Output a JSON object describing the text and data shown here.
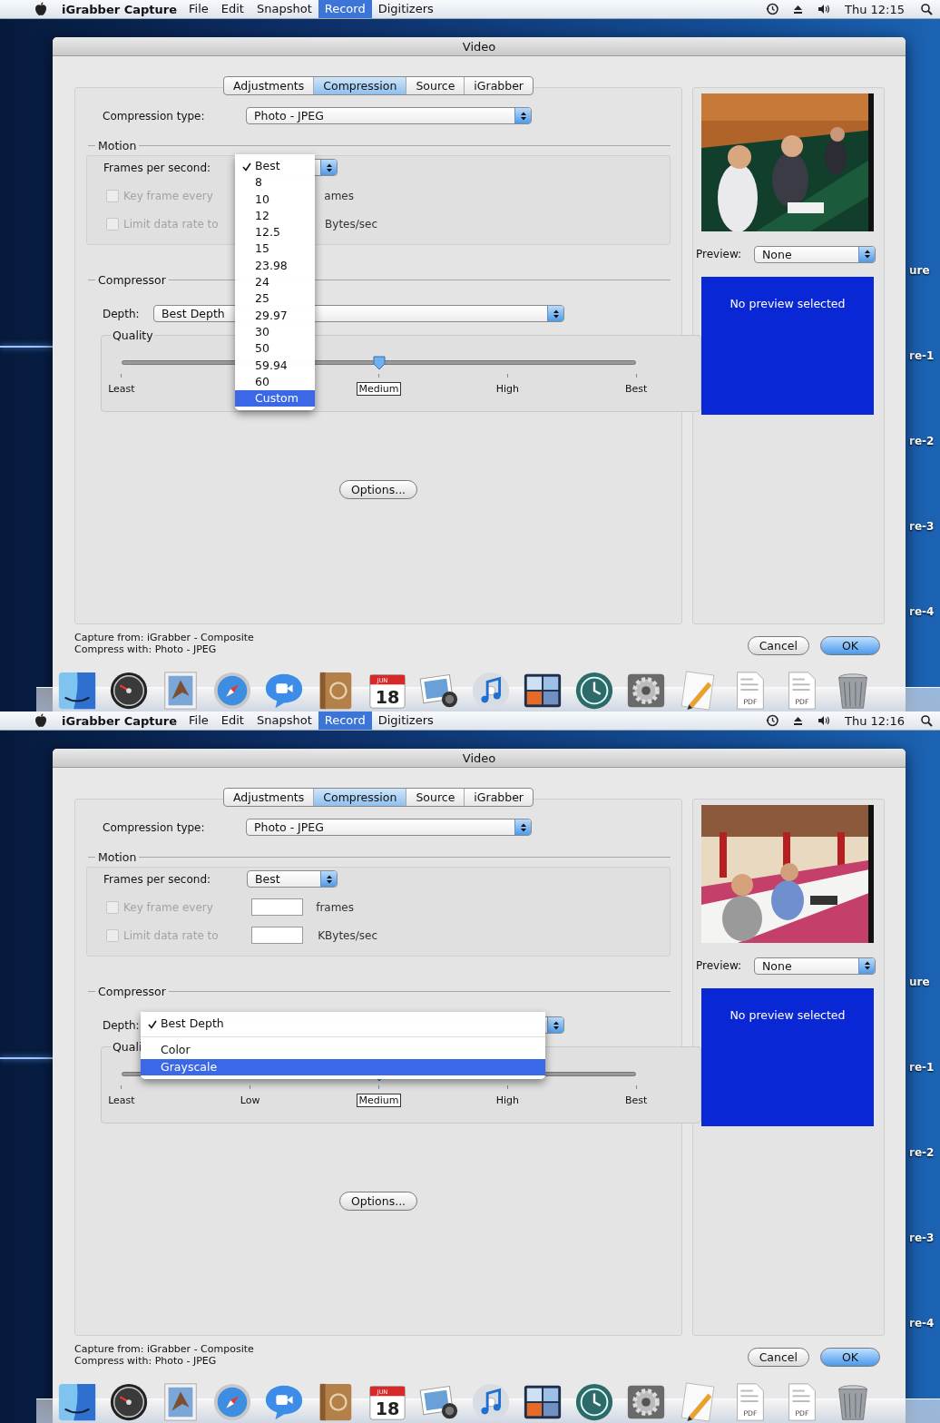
{
  "screens": [
    {
      "menu_bar": {
        "app_name": "iGrabber Capture",
        "menus": [
          {
            "label": "File",
            "selected": false
          },
          {
            "label": "Edit",
            "selected": false
          },
          {
            "label": "Snapshot",
            "selected": false
          },
          {
            "label": "Record",
            "selected": true
          },
          {
            "label": "Digitizers",
            "selected": false
          }
        ],
        "clock": "Thu 12:15"
      },
      "desktop_labels": [
        "ure",
        "re-1",
        "re-2",
        "re-3",
        "re-4"
      ],
      "window": {
        "title": "Video",
        "tabs": [
          {
            "label": "Adjustments",
            "selected": false
          },
          {
            "label": "Compression",
            "selected": true
          },
          {
            "label": "Source",
            "selected": false
          },
          {
            "label": "iGrabber",
            "selected": false
          }
        ],
        "compression_type": {
          "label": "Compression type:",
          "value": "Photo - JPEG"
        },
        "motion": {
          "title": "Motion",
          "fps_label": "Frames per second:",
          "fps_menu": [
            {
              "kind": "item",
              "label": "Best",
              "checked": true,
              "selected": false
            },
            {
              "kind": "item",
              "label": "8",
              "checked": false,
              "selected": false
            },
            {
              "kind": "item",
              "label": "10",
              "checked": false,
              "selected": false
            },
            {
              "kind": "item",
              "label": "12",
              "checked": false,
              "selected": false
            },
            {
              "kind": "item",
              "label": "12.5",
              "checked": false,
              "selected": false
            },
            {
              "kind": "item",
              "label": "15",
              "checked": false,
              "selected": false
            },
            {
              "kind": "item",
              "label": "23.98",
              "checked": false,
              "selected": false
            },
            {
              "kind": "item",
              "label": "24",
              "checked": false,
              "selected": false
            },
            {
              "kind": "item",
              "label": "25",
              "checked": false,
              "selected": false
            },
            {
              "kind": "item",
              "label": "29.97",
              "checked": false,
              "selected": false
            },
            {
              "kind": "item",
              "label": "30",
              "checked": false,
              "selected": false
            },
            {
              "kind": "item",
              "label": "50",
              "checked": false,
              "selected": false
            },
            {
              "kind": "item",
              "label": "59.94",
              "checked": false,
              "selected": false
            },
            {
              "kind": "item",
              "label": "60",
              "checked": false,
              "selected": false
            },
            {
              "kind": "item",
              "label": "Custom",
              "checked": false,
              "selected": true
            }
          ],
          "key_frame": {
            "label": "Key frame every",
            "checked": false,
            "disabled": true,
            "unit": "ames"
          },
          "data_rate": {
            "label": "Limit data rate to",
            "checked": false,
            "disabled": true,
            "unit": "Bytes/sec"
          }
        },
        "compressor": {
          "title": "Compressor",
          "depth_label": "Depth:",
          "depth_value": "Best Depth",
          "quality_title": "Quality",
          "quality": {
            "level": 0.5,
            "tick_labels": {
              "least": "Least",
              "medium": "Medium",
              "high": "High",
              "best": "Best"
            }
          }
        },
        "options_button": "Options...",
        "preview_label": "Preview:",
        "preview_value": "None",
        "preview_message": "No preview selected",
        "status_lines": [
          "Capture from: iGrabber - Composite",
          "Compress with: Photo - JPEG"
        ],
        "buttons": [
          "Cancel",
          "OK"
        ]
      },
      "dock": [
        {
          "kind": "finder"
        },
        {
          "kind": "dashboard"
        },
        {
          "kind": "mail"
        },
        {
          "kind": "safari"
        },
        {
          "kind": "ichat"
        },
        {
          "kind": "address_book"
        },
        {
          "kind": "calendar",
          "month": "JUN",
          "day": "18"
        },
        {
          "kind": "iphoto"
        },
        {
          "kind": "itunes"
        },
        {
          "kind": "spaces"
        },
        {
          "kind": "time_machine"
        },
        {
          "kind": "system_preferences"
        },
        {
          "kind": "textedit"
        },
        {
          "kind": "document",
          "label": "PDF"
        },
        {
          "kind": "document",
          "label": "PDF"
        },
        {
          "kind": "trash"
        }
      ]
    },
    {
      "menu_bar": {
        "app_name": "iGrabber Capture",
        "menus": [
          {
            "label": "File",
            "selected": false
          },
          {
            "label": "Edit",
            "selected": false
          },
          {
            "label": "Snapshot",
            "selected": false
          },
          {
            "label": "Record",
            "selected": true
          },
          {
            "label": "Digitizers",
            "selected": false
          }
        ],
        "clock": "Thu 12:16"
      },
      "desktop_labels": [
        "ure",
        "re-1",
        "re-2",
        "re-3",
        "re-4"
      ],
      "window": {
        "title": "Video",
        "tabs": [
          {
            "label": "Adjustments",
            "selected": false
          },
          {
            "label": "Compression",
            "selected": true
          },
          {
            "label": "Source",
            "selected": false
          },
          {
            "label": "iGrabber",
            "selected": false
          }
        ],
        "compression_type": {
          "label": "Compression type:",
          "value": "Photo - JPEG"
        },
        "motion": {
          "title": "Motion",
          "fps_label": "Frames per second:",
          "fps_value": "Best",
          "key_frame": {
            "label": "Key frame every",
            "checked": false,
            "disabled": true,
            "unit": "frames"
          },
          "data_rate": {
            "label": "Limit data rate to",
            "checked": false,
            "disabled": true,
            "unit": "KBytes/sec"
          }
        },
        "compressor": {
          "title": "Compressor",
          "depth_label": "Depth:",
          "depth_menu": [
            {
              "kind": "item",
              "label": "Best Depth",
              "checked": true,
              "selected": false
            },
            {
              "kind": "separator"
            },
            {
              "kind": "item",
              "label": "Color",
              "checked": false,
              "selected": false
            },
            {
              "kind": "item",
              "label": "Grayscale",
              "checked": false,
              "selected": true
            }
          ],
          "quality_title": "Quali",
          "quality": {
            "level": 0.5,
            "tick_labels": {
              "least": "Least",
              "low": "Low",
              "medium": "Medium",
              "high": "High",
              "best": "Best"
            }
          }
        },
        "options_button": "Options...",
        "preview_label": "Preview:",
        "preview_value": "None",
        "preview_message": "No preview selected",
        "status_lines": [
          "Capture from: iGrabber - Composite",
          "Compress with: Photo - JPEG"
        ],
        "buttons": [
          "Cancel",
          "OK"
        ]
      },
      "dock": [
        {
          "kind": "finder"
        },
        {
          "kind": "dashboard"
        },
        {
          "kind": "mail"
        },
        {
          "kind": "safari"
        },
        {
          "kind": "ichat"
        },
        {
          "kind": "address_book"
        },
        {
          "kind": "calendar",
          "month": "JUN",
          "day": "18"
        },
        {
          "kind": "iphoto"
        },
        {
          "kind": "itunes"
        },
        {
          "kind": "spaces"
        },
        {
          "kind": "time_machine"
        },
        {
          "kind": "system_preferences"
        },
        {
          "kind": "textedit"
        },
        {
          "kind": "document",
          "label": "PDF"
        },
        {
          "kind": "document",
          "label": "PDF"
        },
        {
          "kind": "trash"
        }
      ]
    }
  ]
}
